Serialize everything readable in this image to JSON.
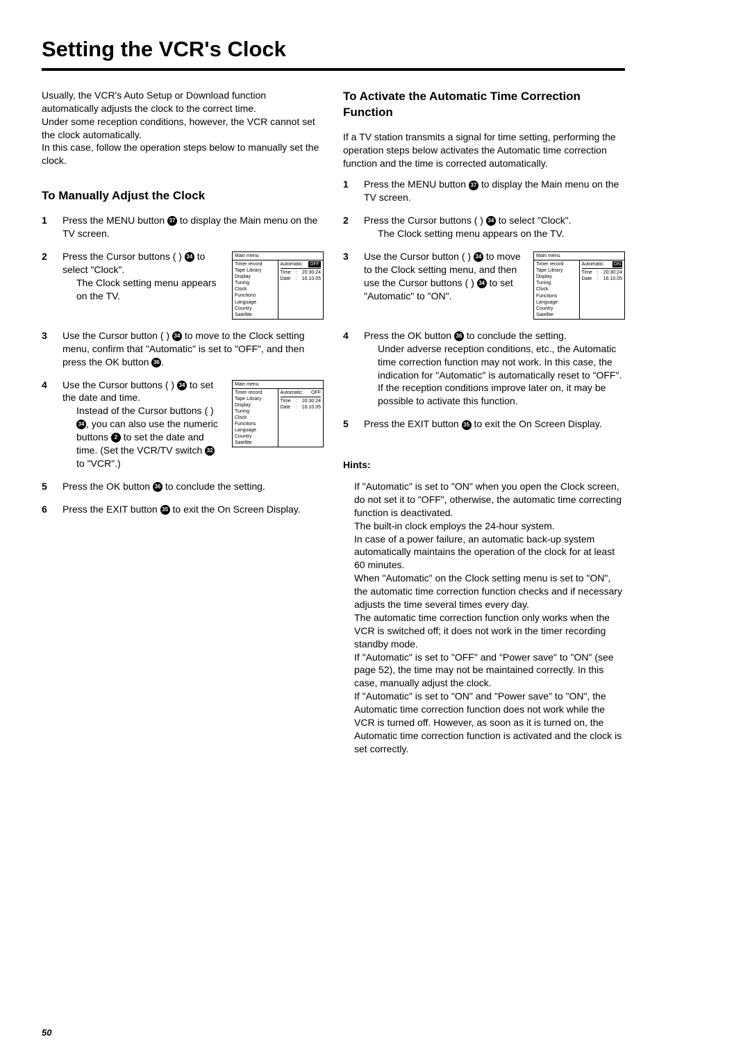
{
  "title": "Setting the VCR's Clock",
  "intro": [
    "Usually, the VCR's Auto Setup or Download function automatically adjusts the clock to the correct time.",
    "Under some reception conditions, however, the VCR cannot set the clock automatically.",
    "In this case, follow the operation steps below to manually set the clock."
  ],
  "left": {
    "heading": "To Manually Adjust the Clock",
    "steps": {
      "s1a": "Press the MENU button ",
      "s1b": " to display the Main menu on the TV screen.",
      "s2a": "Press the Cursor buttons (        ) ",
      "s2b": " to select \"Clock\".",
      "s2c": "The Clock setting menu appears on the TV.",
      "s3a": "Use the Cursor button (   ) ",
      "s3b": " to move to the Clock setting menu, confirm that \"Automatic\" is set to \"OFF\", and then press the OK button ",
      "s3c": ".",
      "s4a": "Use the Cursor buttons (            ) ",
      "s4b": " to set the date and time.",
      "s4c": "Instead of the Cursor buttons (            ) ",
      "s4d": ", you can also use the numeric buttons ",
      "s4e": " to set the date and time. (Set the VCR/TV switch ",
      "s4f": " to \"VCR\".)",
      "s5a": "Press the OK button ",
      "s5b": " to conclude the setting.",
      "s6a": "Press the EXIT button ",
      "s6b": " to exit the On Screen Display."
    }
  },
  "right": {
    "heading": "To Activate the Automatic Time Correction Function",
    "intro": "If a TV station transmits a signal for time setting, performing the operation steps below activates the Automatic time correction function and the time is corrected automatically.",
    "steps": {
      "s1a": "Press the MENU button ",
      "s1b": " to display the Main menu on the TV screen.",
      "s2a": "Press the Cursor buttons (        ) ",
      "s2b": " to select \"Clock\".",
      "s2c": "The Clock setting menu appears on the TV.",
      "s3a": "Use the Cursor button (    ) ",
      "s3b": " to move to the Clock setting menu, and then use the Cursor buttons (       ) ",
      "s3c": " to set \"Automatic\" to \"ON\".",
      "s4a": "Press the OK button ",
      "s4b": " to conclude the setting.",
      "s4c": "Under adverse reception conditions, etc., the Automatic time correction function may not work. In this case, the indication for \"Automatic\" is automatically reset to \"OFF\".",
      "s4d": "If the reception conditions improve later on, it may be possible to activate this function.",
      "s5a": "Press the EXIT button ",
      "s5b": " to exit the On Screen Display."
    }
  },
  "hints_title": "Hints:",
  "hints": [
    "If \"Automatic\" is set to \"ON\" when you open the Clock screen, do not set it to \"OFF\", otherwise, the automatic time correcting function is deactivated.",
    "The built-in clock employs the 24-hour system.",
    "In case of a power failure, an automatic back-up system automatically maintains the operation of the clock for at least 60 minutes.",
    "When \"Automatic\" on the Clock setting menu is set to \"ON\", the automatic time correction function checks and if necessary adjusts the time several times every day.",
    "The automatic time correction function only works when the VCR is switched off; it does not work in the timer recording standby mode.",
    "If \"Automatic\" is set to \"OFF\" and \"Power save\" to \"ON\" (see page 52), the time may not be maintained correctly. In this case, manually adjust the clock.",
    "If \"Automatic\" is set to \"ON\" and \"Power save\" to \"ON\", the Automatic time correction function does not work while the VCR is turned off. However, as soon as it is turned on, the Automatic time correction function is activated and the clock is set correctly."
  ],
  "refs": {
    "r37": "37",
    "r34": "34",
    "r36": "36",
    "r2": "2",
    "r32": "32",
    "r35": "35"
  },
  "osd": {
    "title": "Main menu",
    "menu": [
      "Timer record",
      "Tape Library",
      "Display",
      "Tuning",
      "Clock",
      "Functions",
      "Language",
      "Country",
      "Satellite"
    ],
    "auto_label": "Automatic:",
    "off": "OFF",
    "on": "ON",
    "time_label": "Time",
    "time_val": "20:30:24",
    "date_label": "Date",
    "date_val": "16.10.05"
  },
  "page_num": "50"
}
